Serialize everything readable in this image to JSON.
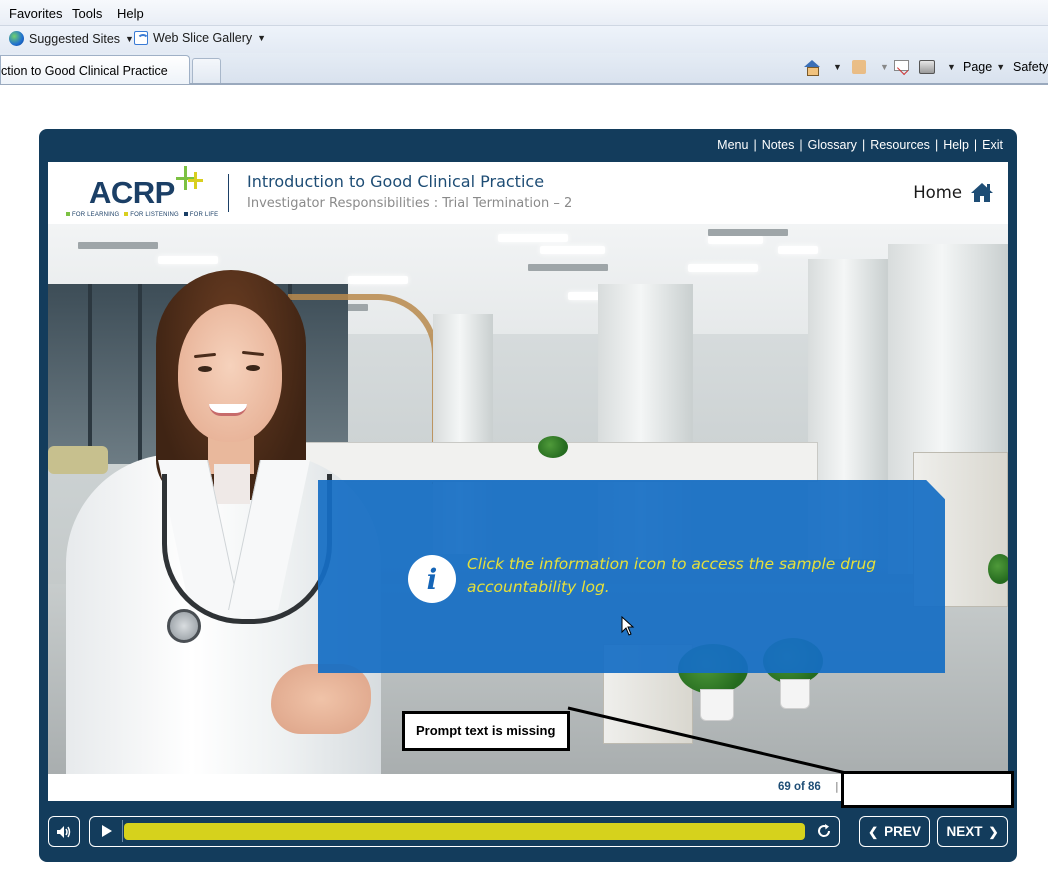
{
  "browser": {
    "menu": [
      "Favorites",
      "Tools",
      "Help"
    ],
    "favorites": [
      {
        "label": "Suggested Sites",
        "icon": "globe-icon"
      },
      {
        "label": "Web Slice Gallery",
        "icon": "web-slice-icon"
      }
    ],
    "tab_title": "ction to Good Clinical Practice",
    "commands": {
      "page": "Page",
      "safety": "Safety"
    }
  },
  "course": {
    "top_nav": [
      "Menu",
      "Notes",
      "Glossary",
      "Resources",
      "Help",
      "Exit"
    ],
    "logo": {
      "text": "ACRP",
      "tagline": [
        "FOR LEARNING",
        "FOR LISTENING",
        "FOR LIFE"
      ],
      "colors": {
        "green": "#7cc142",
        "yellow": "#d9cf1f",
        "navy": "#1b3f66"
      }
    },
    "title": "Introduction to Good Clinical Practice",
    "subtitle": "Investigator Responsibilities : Trial Termination – 2",
    "home_label": "Home",
    "info_text": "Click the information icon to access the sample drug accountability log.",
    "prompt_missing": "Prompt text is missing",
    "page_count": "69 of 86",
    "controls": {
      "prev": "PREV",
      "next": "NEXT"
    },
    "colors": {
      "frame": "#133c5c",
      "panel": "#156ec4",
      "panel_text": "#e6e03a",
      "progress": "#d6d21c"
    }
  }
}
